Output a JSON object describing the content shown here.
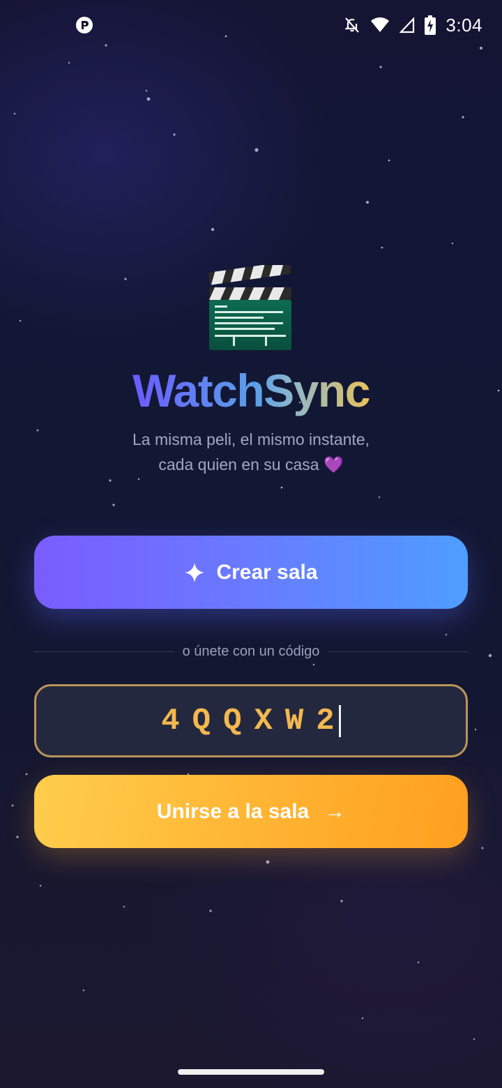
{
  "status_bar": {
    "time": "3:04",
    "left_icons": [
      "app-notification-icon"
    ],
    "right_icons": [
      "notifications-off-icon",
      "wifi-icon",
      "cell-signal-icon",
      "battery-charging-icon"
    ]
  },
  "hero": {
    "icon": "clapperboard-icon",
    "title": "WatchSync",
    "tagline_line1": "La misma peli, el mismo instante,",
    "tagline_line2": "cada quien en su casa",
    "tagline_emoji": "💜"
  },
  "create_button": {
    "icon": "sparkle-icon",
    "label": "Crear sala"
  },
  "divider": {
    "text": "o únete con un código"
  },
  "code_input": {
    "value": "4QQXW2"
  },
  "join_button": {
    "label": "Unirse a la sala",
    "arrow": "→"
  },
  "colors": {
    "background_top": "#141433",
    "background_bottom": "#1c1830",
    "create_gradient_start": "#7a5cff",
    "create_gradient_end": "#4f9dff",
    "join_gradient_start": "#ffcd4c",
    "join_gradient_end": "#ff9f1f",
    "code_text": "#f3b84e",
    "code_border": "#b9955a"
  }
}
